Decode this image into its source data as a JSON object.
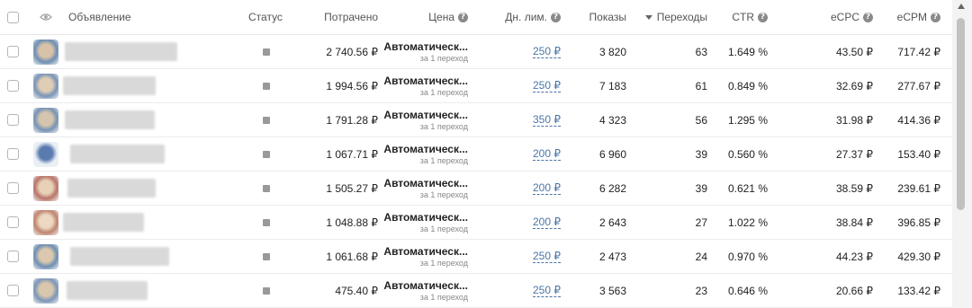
{
  "header": {
    "ad": "Объявление",
    "status": "Статус",
    "spent": "Потрачено",
    "price": "Цена",
    "daily_limit": "Дн. лим.",
    "impressions": "Показы",
    "clicks": "Переходы",
    "ctr": "CTR",
    "ecpc": "eCPC",
    "ecpm": "eCPM",
    "help_glyph": "?"
  },
  "rows": [
    {
      "spent": "2 740.56 ₽",
      "price": "Автоматическ...",
      "price_sub": "за 1 переход",
      "limit": "250 ₽",
      "impressions": "3 820",
      "clicks": "63",
      "ctr": "1.649 %",
      "ecpc": "43.50 ₽",
      "ecpm": "717.42 ₽"
    },
    {
      "spent": "1 994.56 ₽",
      "price": "Автоматическ...",
      "price_sub": "за 1 переход",
      "limit": "250 ₽",
      "impressions": "7 183",
      "clicks": "61",
      "ctr": "0.849 %",
      "ecpc": "32.69 ₽",
      "ecpm": "277.67 ₽"
    },
    {
      "spent": "1 791.28 ₽",
      "price": "Автоматическ...",
      "price_sub": "за 1 переход",
      "limit": "350 ₽",
      "impressions": "4 323",
      "clicks": "56",
      "ctr": "1.295 %",
      "ecpc": "31.98 ₽",
      "ecpm": "414.36 ₽"
    },
    {
      "spent": "1 067.71 ₽",
      "price": "Автоматическ...",
      "price_sub": "за 1 переход",
      "limit": "200 ₽",
      "impressions": "6 960",
      "clicks": "39",
      "ctr": "0.560 %",
      "ecpc": "27.37 ₽",
      "ecpm": "153.40 ₽"
    },
    {
      "spent": "1 505.27 ₽",
      "price": "Автоматическ...",
      "price_sub": "за 1 переход",
      "limit": "200 ₽",
      "impressions": "6 282",
      "clicks": "39",
      "ctr": "0.621 %",
      "ecpc": "38.59 ₽",
      "ecpm": "239.61 ₽"
    },
    {
      "spent": "1 048.88 ₽",
      "price": "Автоматическ...",
      "price_sub": "за 1 переход",
      "limit": "200 ₽",
      "impressions": "2 643",
      "clicks": "27",
      "ctr": "1.022 %",
      "ecpc": "38.84 ₽",
      "ecpm": "396.85 ₽"
    },
    {
      "spent": "1 061.68 ₽",
      "price": "Автоматическ...",
      "price_sub": "за 1 переход",
      "limit": "250 ₽",
      "impressions": "2 473",
      "clicks": "24",
      "ctr": "0.970 %",
      "ecpc": "44.23 ₽",
      "ecpm": "429.30 ₽"
    },
    {
      "spent": "475.40 ₽",
      "price": "Автоматическ...",
      "price_sub": "за 1 переход",
      "limit": "250 ₽",
      "impressions": "3 563",
      "clicks": "23",
      "ctr": "0.646 %",
      "ecpc": "20.66 ₽",
      "ecpm": "133.42 ₽"
    }
  ],
  "colors": {
    "link": "#4a76a8",
    "status_icon": "#999999",
    "border": "#ececec"
  }
}
